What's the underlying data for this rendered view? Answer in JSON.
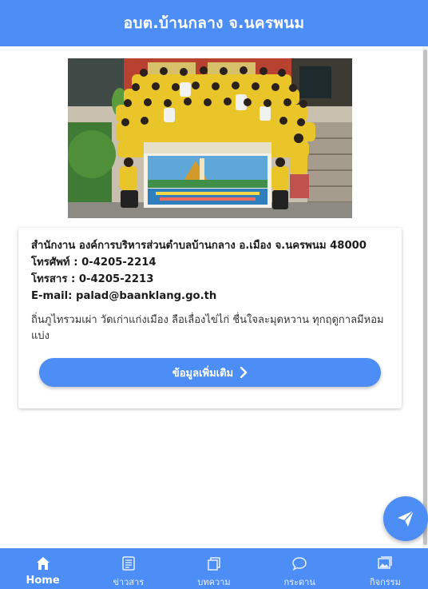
{
  "header": {
    "title": "อบต.บ้านกลาง จ.นครพนม"
  },
  "hero": {
    "alt": "group-photo",
    "banner_text": "องค์การบริหารส่วนตำบลบ้านกลาง"
  },
  "info": {
    "address": "สำนักงาน องค์การบริหารส่วนตำบลบ้านกลาง อ.เมือง จ.นครพนม 48000",
    "phone": "โทรศัพท์ : 0-4205-2214",
    "fax": "โทรสาร : 0-4205-2213",
    "email": "E-mail: palad@baanklang.go.th",
    "description": "ถิ่นภูไทรวมเผ่า วัดเก่าแก่งเมือง ลือเลื่องไข่ไก่ ชื่นใจละมุดหวาน ทุกฤดูกาลมีหอมแบ่ง",
    "more_label": "ข้อมูลเพิ่มเติม"
  },
  "bottom_nav": {
    "items": [
      {
        "label": "Home",
        "icon": "home-icon"
      },
      {
        "label": "ข่าวสาร",
        "icon": "news-icon"
      },
      {
        "label": "บทความ",
        "icon": "articles-icon"
      },
      {
        "label": "กระดาน",
        "icon": "board-icon"
      },
      {
        "label": "กิจกรรม",
        "icon": "gallery-icon"
      }
    ]
  },
  "colors": {
    "primary": "#4d8df6",
    "text": "#1b1b1b",
    "background": "#ffffff"
  }
}
